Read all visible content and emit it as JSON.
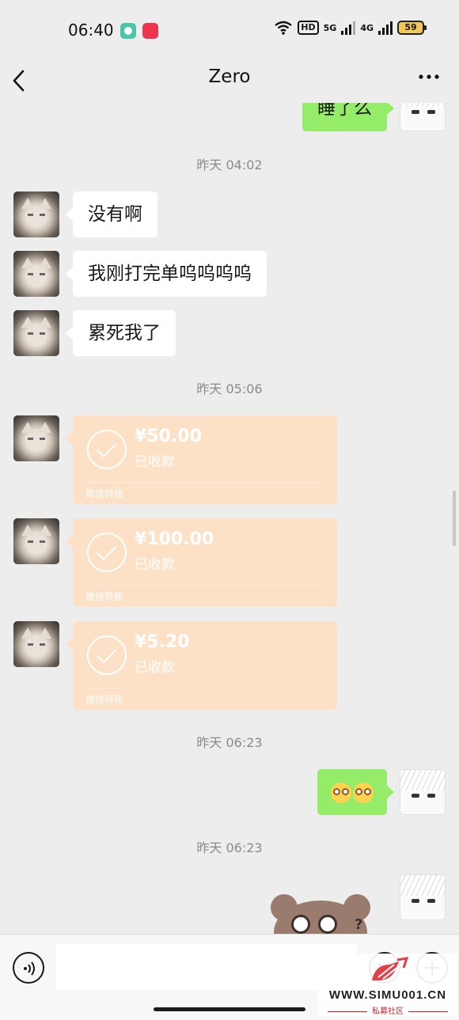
{
  "status_bar": {
    "time": "06:40",
    "network_hd": "HD",
    "net_5g": "5G",
    "net_4g": "4G",
    "battery": "59"
  },
  "header": {
    "title": "Zero",
    "back_icon": "chevron-left-icon",
    "more_icon": "more-dots-icon"
  },
  "messages": {
    "partial_top": "睡了么",
    "ts1": "昨天 04:02",
    "m1": "没有啊",
    "m2": "我刚打完单呜呜呜呜",
    "m3": "累死我了",
    "ts2": "昨天 05:06",
    "transfers": [
      {
        "amount": "¥50.00",
        "status": "已收款",
        "label": "微信转账"
      },
      {
        "amount": "¥100.00",
        "status": "已收款",
        "label": "微信转账"
      },
      {
        "amount": "¥5.20",
        "status": "已收款",
        "label": "微信转账"
      }
    ],
    "ts3": "昨天 06:23",
    "ts4": "昨天 06:23"
  },
  "input_bar": {
    "value": "",
    "voice_icon": "voice-icon",
    "emoji_icon": "emoji-icon",
    "plus_icon": "plus-icon"
  },
  "watermark": {
    "url": "WWW.SIMU001.CN",
    "sub": "私募社区"
  },
  "colors": {
    "background": "#ededed",
    "bubble_self": "#95ec69",
    "bubble_other": "#ffffff",
    "transfer_received": "#fde1c6"
  }
}
